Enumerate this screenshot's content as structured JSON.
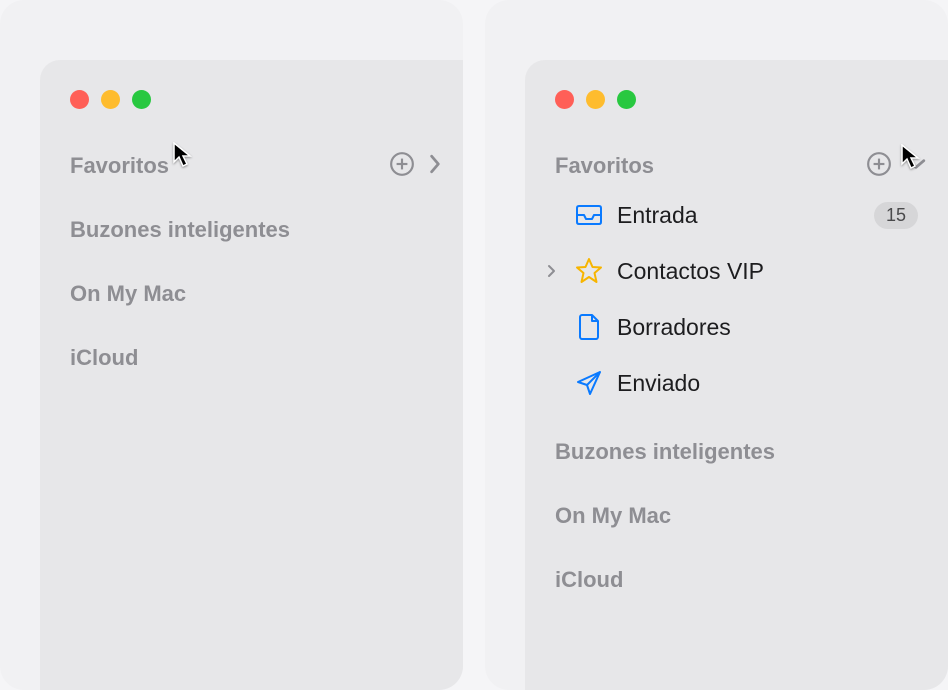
{
  "left": {
    "sections": {
      "favorites": "Favoritos",
      "smart": "Buzones inteligentes",
      "onmymac": "On My Mac",
      "icloud": "iCloud"
    }
  },
  "right": {
    "sections": {
      "favorites": "Favoritos",
      "smart": "Buzones inteligentes",
      "onmymac": "On My Mac",
      "icloud": "iCloud"
    },
    "favorites_items": {
      "inbox": {
        "label": "Entrada",
        "badge": "15"
      },
      "vip": {
        "label": "Contactos VIP"
      },
      "drafts": {
        "label": "Borradores"
      },
      "sent": {
        "label": "Enviado"
      }
    }
  }
}
